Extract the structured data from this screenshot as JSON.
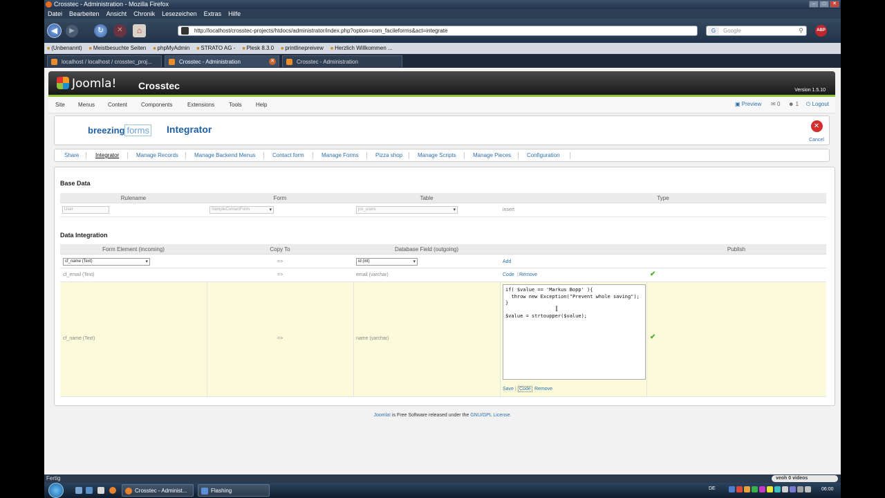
{
  "window": {
    "title": "Crosstec - Administration - Mozilla Firefox"
  },
  "menubar": [
    "Datei",
    "Bearbeiten",
    "Ansicht",
    "Chronik",
    "Lesezeichen",
    "Extras",
    "Hilfe"
  ],
  "navbar": {
    "url": "http://localhost/crosstec-projects/htdocs/administrator/index.php?option=com_facileforms&act=integrate",
    "search_placeholder": "Google",
    "search_engine": "G",
    "abp": "ABP"
  },
  "bookmarks": [
    "(Unbenannt)",
    "Meistbesuchte Seiten",
    "phpMyAdmin",
    "STRATO AG -",
    "Plesk 8.3.0",
    "printlinepreivew",
    "Herzlich Willkommen ..."
  ],
  "tabs": [
    {
      "label": "localhost / localhost / crosstec_proj..."
    },
    {
      "label": "Crosstec - Administration"
    },
    {
      "label": "Crosstec - Administration"
    }
  ],
  "joomla": {
    "logo": "Joomla!",
    "site": "Crosstec",
    "version": "Version 1.5.10",
    "menu": [
      "Site",
      "Menus",
      "Content",
      "Components",
      "Extensions",
      "Tools",
      "Help"
    ],
    "menu_right": {
      "preview": "Preview",
      "messages": "0",
      "users": "1",
      "logout": "Logout"
    }
  },
  "panel": {
    "logo_main": "breezing",
    "logo_sub": "forms",
    "title": "Integrator",
    "cancel": "Cancel"
  },
  "subtabs": [
    "Share",
    "Integrator",
    "Manage Records",
    "Manage Backend Menus",
    "Contact form",
    "Manage Forms",
    "Pizza shop",
    "Manage Scripts",
    "Manage Pieces",
    "Configuration"
  ],
  "base_data": {
    "title": "Base Data",
    "headers": [
      "Rulename",
      "Form",
      "Table",
      "Type"
    ],
    "row": {
      "rulename": "User",
      "form": "SampleContactForm",
      "table": "jos_users",
      "type": "insert"
    }
  },
  "data_integration": {
    "title": "Data Integration",
    "headers": [
      "Form Element (incoming)",
      "Copy To",
      "Database Field (outgoing)",
      "",
      "Publish"
    ],
    "add_row": {
      "element": "cf_name (Text)",
      "arrow": "=>",
      "field": "id (int)",
      "action": "Add"
    },
    "rows": [
      {
        "element": "cf_email (Text)",
        "arrow": "=>",
        "field": "email (varchar)",
        "code": "Code",
        "remove": "Remove"
      },
      {
        "element": "cf_name (Text)",
        "arrow": "=>",
        "field": "name (varchar)",
        "save": "Save",
        "code": "Code",
        "remove": "Remove"
      }
    ],
    "code_text": "if( $value == 'Markus Bopp' ){\n  throw new Exception(\"Prevent whole saving\");\n}\n\n$value = strtoupper($value);"
  },
  "footer": {
    "joomla": "Joomla!",
    "text": " is Free Software released under the ",
    "license": "GNU/GPL License."
  },
  "statusbar": {
    "text": "Fertig",
    "veoh": "veoh  0 videos"
  },
  "taskbar": {
    "tasks": [
      "Crosstec - Administ...",
      "Flashing"
    ],
    "lang": "DE",
    "clock": "06:00"
  }
}
